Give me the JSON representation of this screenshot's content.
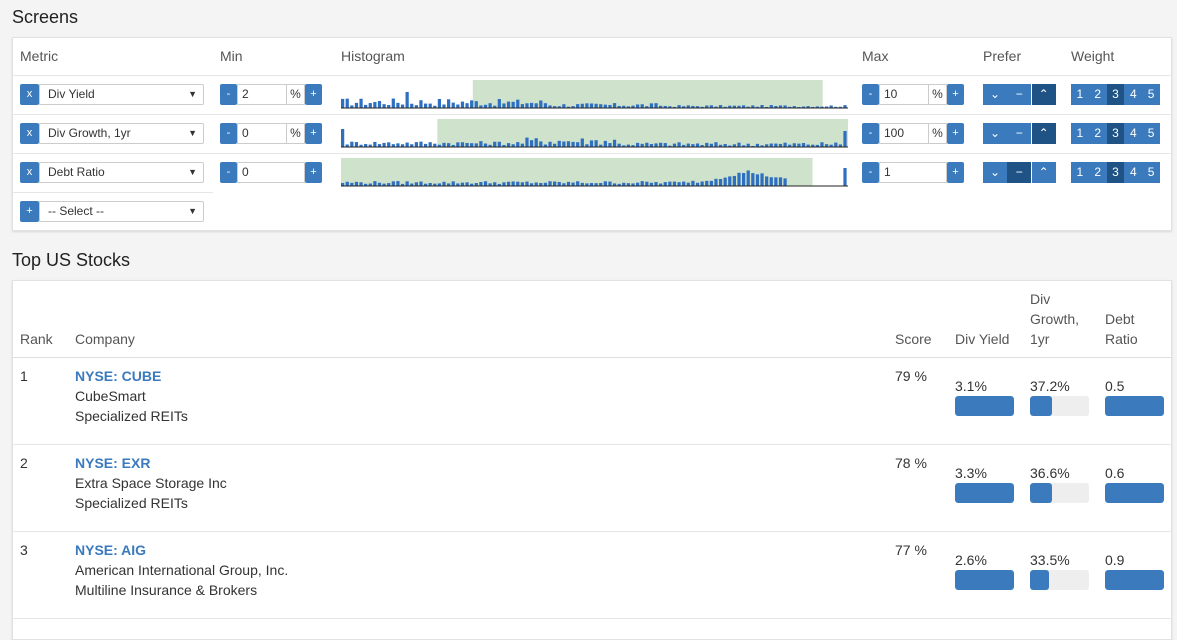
{
  "screens": {
    "title": "Screens",
    "headers": {
      "metric": "Metric",
      "min": "Min",
      "histogram": "Histogram",
      "max": "Max",
      "prefer": "Prefer",
      "weight": "Weight"
    },
    "remove_label": "x",
    "minus_label": "-",
    "plus_label": "+",
    "weights": [
      "1",
      "2",
      "3",
      "4",
      "5"
    ],
    "rows": [
      {
        "metric": "Div Yield",
        "min": "2",
        "min_unit": "%",
        "max": "10",
        "max_unit": "%",
        "prefer": "up",
        "weight": 3,
        "hist": {
          "highlight_start": 0.26,
          "highlight_end": 0.95
        }
      },
      {
        "metric": "Div Growth, 1yr",
        "min": "0",
        "min_unit": "%",
        "max": "100",
        "max_unit": "%",
        "prefer": "up",
        "weight": 3,
        "hist": {
          "highlight_start": 0.19,
          "highlight_end": 1.0
        }
      },
      {
        "metric": "Debt Ratio",
        "min": "0",
        "min_unit": "",
        "max": "1",
        "max_unit": "",
        "prefer": "none",
        "weight": 3,
        "hist": {
          "highlight_start": 0.0,
          "highlight_end": 0.93
        }
      }
    ],
    "add_select": {
      "label": "-- Select --"
    }
  },
  "stocks": {
    "title": "Top US Stocks",
    "headers": {
      "rank": "Rank",
      "company": "Company",
      "score": "Score",
      "div_yield": "Div Yield",
      "div_growth": "Div Growth, 1yr",
      "debt_ratio": "Debt Ratio"
    },
    "rows": [
      {
        "rank": "1",
        "ticker": "NYSE: CUBE",
        "name": "CubeSmart",
        "industry": "Specialized REITs",
        "score": "79 %",
        "div_yield": "3.1%",
        "div_growth": "37.2%",
        "debt_ratio": "0.5",
        "bars": {
          "div_yield": 1.0,
          "div_growth": 0.37,
          "debt_ratio": 1.0
        }
      },
      {
        "rank": "2",
        "ticker": "NYSE: EXR",
        "name": "Extra Space Storage Inc",
        "industry": "Specialized REITs",
        "score": "78 %",
        "div_yield": "3.3%",
        "div_growth": "36.6%",
        "debt_ratio": "0.6",
        "bars": {
          "div_yield": 1.0,
          "div_growth": 0.37,
          "debt_ratio": 1.0
        }
      },
      {
        "rank": "3",
        "ticker": "NYSE: AIG",
        "name": "American International Group, Inc.",
        "industry": "Multiline Insurance & Brokers",
        "score": "77 %",
        "div_yield": "2.6%",
        "div_growth": "33.5%",
        "debt_ratio": "0.9",
        "bars": {
          "div_yield": 1.0,
          "div_growth": 0.33,
          "debt_ratio": 1.0
        }
      }
    ]
  },
  "colors": {
    "primary": "#3a7abd",
    "active": "#1f5285",
    "hist_highlight": "#cfe3cc",
    "hist_bar": "#2f6fc0"
  }
}
